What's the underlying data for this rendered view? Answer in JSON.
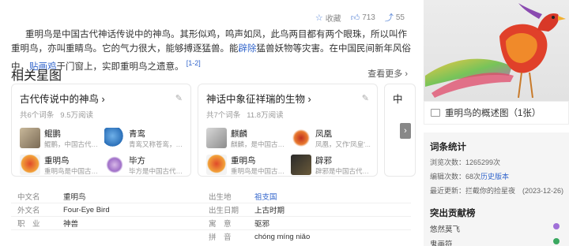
{
  "actions": {
    "favorite_label": "收藏",
    "like_count": "713",
    "share_count": "55"
  },
  "intro": {
    "p1": "重明鸟是中国古代神话传说中的神鸟。其形似鸡，鸣声如凤，此鸟两目都有两个眼珠，所以叫作重明鸟，亦叫重睛鸟。它的气力很大，能够搏逐猛兽。能",
    "link1": "辟除",
    "p2": "猛兽妖物等灾害。在中国民间新年风俗中，",
    "link2": "贴画鸡",
    "p3": "于门窗上，实即重明鸟之遗意。",
    "ref": "[1-2]"
  },
  "related": {
    "title": "相关星图",
    "more": "查看更多",
    "cards": [
      {
        "title": "古代传说中的神鸟",
        "count": "共6个词条",
        "views": "9.5万阅读",
        "items": [
          {
            "name": "鲲鹏",
            "desc": "鲲鹏，中国古代神..."
          },
          {
            "name": "青鸾",
            "desc": "青鸾又称苍鸾，青..."
          },
          {
            "name": "重明鸟",
            "desc": "重明鸟是中国古代..."
          },
          {
            "name": "毕方",
            "desc": "毕方是中国古代神..."
          }
        ]
      },
      {
        "title": "神话中象征祥瑞的生物",
        "count": "共7个词条",
        "views": "11.8万阅读",
        "items": [
          {
            "name": "麒麟",
            "desc": "麒麟，是中国古代..."
          },
          {
            "name": "凤凰",
            "desc": "凤凰，又作'凤皇'..."
          },
          {
            "name": "重明鸟",
            "desc": "重明鸟是中国古代..."
          },
          {
            "name": "辟邪",
            "desc": "辟邪是中国古代神..."
          }
        ]
      },
      {
        "title": "中"
      }
    ]
  },
  "info": [
    {
      "k1": "中文名",
      "v1": "重明鸟",
      "k2": "出生地",
      "v2": "祖支国"
    },
    {
      "k1": "外文名",
      "v1": "Four-Eye Bird",
      "k2": "出生日期",
      "v2": "上古时期"
    },
    {
      "k1": "职　业",
      "v1": "神兽",
      "k2": "寓　意",
      "v2": "驱邪"
    },
    {
      "k1": "",
      "v1": "",
      "k2": "拼　音",
      "v2": "chóng míng niǎo"
    }
  ],
  "sidebar": {
    "caption": "重明鸟的概述图（1张）",
    "stats_title": "词条统计",
    "views_label": "浏览次数：",
    "views_value": "1265299次",
    "edits_label": "编辑次数：",
    "edits_value": "68次",
    "history_link": "历史版本",
    "updated_label": "最近更新：",
    "updated_value": "拦截你的捡星夜　(2023-12-26)",
    "top_title": "突出贡献榜",
    "contributors": [
      "悠然莫飞",
      "鬼画符"
    ]
  },
  "colors": {
    "link": "#3366cc",
    "accent": "#5f8ad8"
  }
}
